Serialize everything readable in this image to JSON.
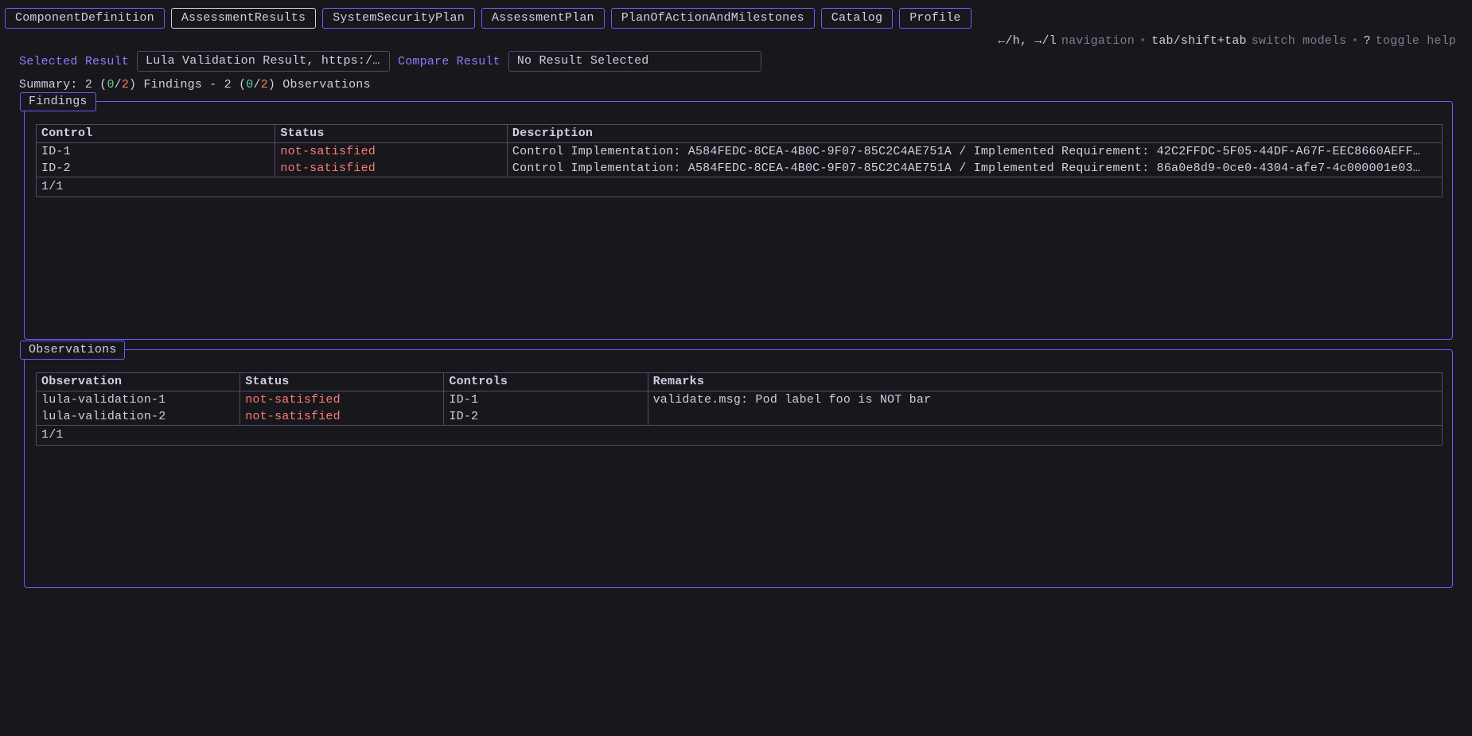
{
  "tabs": {
    "items": [
      {
        "label": "ComponentDefinition",
        "active": false
      },
      {
        "label": "AssessmentResults",
        "active": true
      },
      {
        "label": "SystemSecurityPlan",
        "active": false
      },
      {
        "label": "AssessmentPlan",
        "active": false
      },
      {
        "label": "PlanOfActionAndMilestones",
        "active": false
      },
      {
        "label": "Catalog",
        "active": false
      },
      {
        "label": "Profile",
        "active": false
      }
    ]
  },
  "help": {
    "nav_keys": "←/h, →/l",
    "nav_label": "navigation",
    "tab_keys": "tab/shift+tab",
    "tab_label": "switch models",
    "help_key": "?",
    "help_label": "toggle help",
    "sep": "•"
  },
  "results": {
    "selected_label": "Selected Result",
    "selected_value": "Lula Validation Result, https://github.…",
    "compare_label": "Compare Result",
    "compare_value": "No Result Selected"
  },
  "summary": {
    "prefix": "Summary: ",
    "f_total": "2",
    "f_pass": "0",
    "f_fail": "2",
    "f_label": " Findings - ",
    "o_total": "2",
    "o_pass": "0",
    "o_fail": "2",
    "o_label": " Observations"
  },
  "findings": {
    "panel_title": "Findings",
    "headers": {
      "control": "Control",
      "status": "Status",
      "description": "Description"
    },
    "rows": [
      {
        "control": "ID-1",
        "status": "not-satisfied",
        "description": "Control Implementation: A584FEDC-8CEA-4B0C-9F07-85C2C4AE751A / Implemented Requirement: 42C2FFDC-5F05-44DF-A67F-EEC8660AEFF…"
      },
      {
        "control": "ID-2",
        "status": "not-satisfied",
        "description": "Control Implementation: A584FEDC-8CEA-4B0C-9F07-85C2C4AE751A / Implemented Requirement: 86a0e8d9-0ce0-4304-afe7-4c000001e03…"
      }
    ],
    "footer": "1/1"
  },
  "observations": {
    "panel_title": "Observations",
    "headers": {
      "observation": "Observation",
      "status": "Status",
      "controls": "Controls",
      "remarks": "Remarks"
    },
    "rows": [
      {
        "observation": "lula-validation-1",
        "status": "not-satisfied",
        "controls": "ID-1",
        "remarks": "validate.msg: Pod label foo is NOT bar"
      },
      {
        "observation": "lula-validation-2",
        "status": "not-satisfied",
        "controls": "ID-2",
        "remarks": ""
      }
    ],
    "footer": "1/1"
  }
}
